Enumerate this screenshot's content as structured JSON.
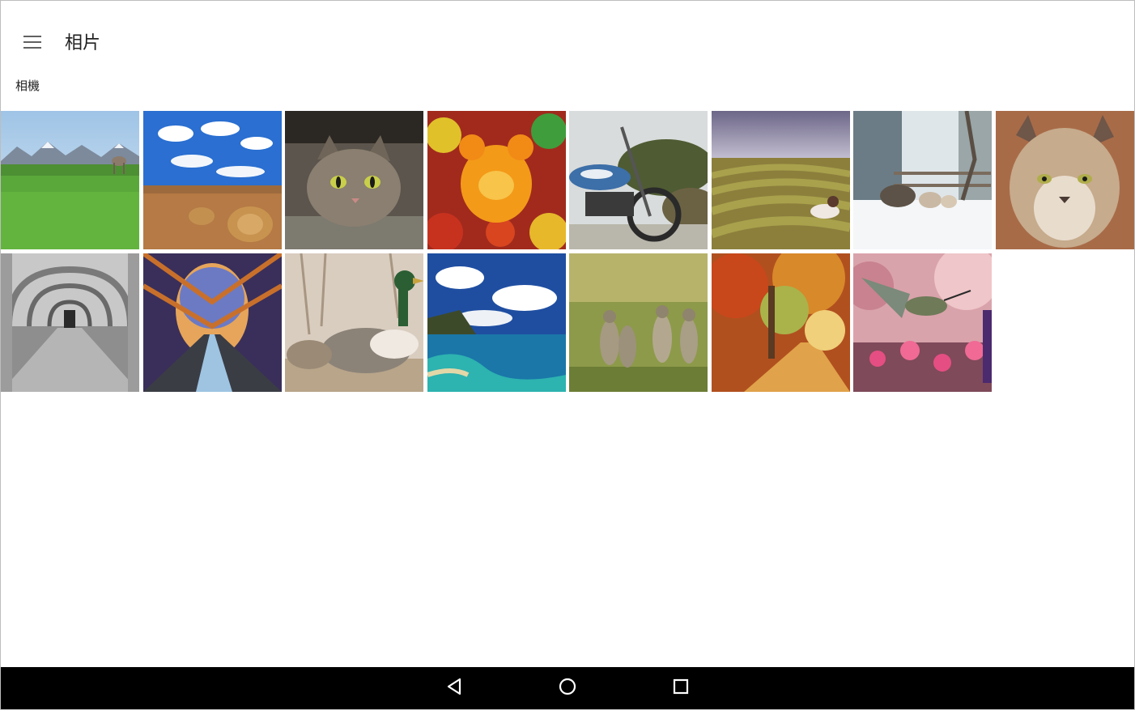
{
  "app": {
    "title": "相片",
    "section_label": "相機"
  },
  "icons": {
    "menu": "menu-icon",
    "back": "back-triangle-icon",
    "home": "home-circle-icon",
    "recents": "recents-square-icon"
  },
  "colors": {
    "background": "#ffffff",
    "text": "#212121",
    "nav_bar": "#000000",
    "nav_icon": "#ffffff",
    "menu_icon": "#616161"
  },
  "photos": [
    {
      "subject": "cow-meadow"
    },
    {
      "subject": "hay-bales"
    },
    {
      "subject": "tabby-cat"
    },
    {
      "subject": "gummy-bears"
    },
    {
      "subject": "motorcycle"
    },
    {
      "subject": "field-stripes"
    },
    {
      "subject": "sheep-snow"
    },
    {
      "subject": "lynx"
    },
    {
      "subject": "cloister"
    },
    {
      "subject": "bridge"
    },
    {
      "subject": "ducks"
    },
    {
      "subject": "coast"
    },
    {
      "subject": "ground-squirrels"
    },
    {
      "subject": "autumn-path"
    },
    {
      "subject": "hummingbird"
    }
  ]
}
